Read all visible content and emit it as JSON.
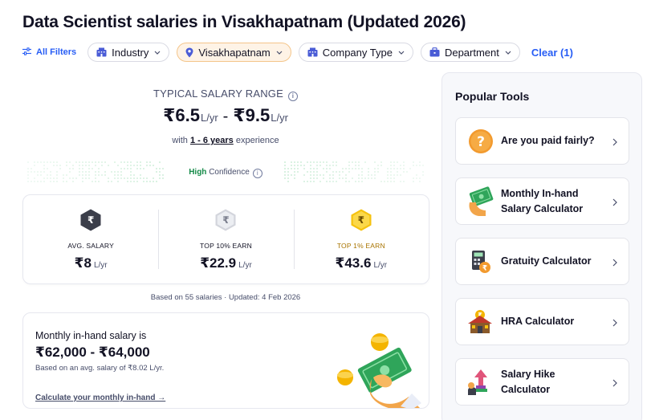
{
  "page": {
    "title": "Data Scientist salaries in Visakhapatnam (Updated 2026)"
  },
  "filters": {
    "all_filters": "All Filters",
    "chips": [
      {
        "label": "Industry",
        "icon": "building-icon",
        "active": false
      },
      {
        "label": "Visakhapatnam",
        "icon": "location-pin-icon",
        "active": true
      },
      {
        "label": "Company Type",
        "icon": "building-icon",
        "active": false
      },
      {
        "label": "Department",
        "icon": "briefcase-icon",
        "active": false
      }
    ],
    "clear": "Clear (1)"
  },
  "salary": {
    "typical_label": "TYPICAL SALARY RANGE",
    "currency": "₹",
    "low": "6.5",
    "high": "9.5",
    "unit": "L/yr",
    "exp_prefix": "with",
    "exp_range": "1 - 6 years",
    "exp_suffix": "experience",
    "confidence_level": "High",
    "confidence_word": "Confidence"
  },
  "stats": [
    {
      "label": "AVG. SALARY",
      "value": "₹8",
      "unit": "L/yr",
      "icon": "rupee-hex-icon",
      "color": "#3b3e4a"
    },
    {
      "label": "TOP 10% EARN",
      "value": "₹22.9",
      "unit": "L/yr",
      "icon": "rupee-hex-icon",
      "color": "#c9cbd3"
    },
    {
      "label": "TOP 1% EARN",
      "value": "₹43.6",
      "unit": "L/yr",
      "icon": "rupee-hex-icon",
      "color": "#f6c20f"
    }
  ],
  "based_on": "Based on 55 salaries · Updated: 4 Feb 2026",
  "inhand": {
    "title": "Monthly in-hand salary is",
    "range": "₹62,000 - ₹64,000",
    "note": "Based on an avg. salary of ₹8.02 L/yr.",
    "link": "Calculate your monthly in-hand →"
  },
  "sidebar": {
    "title": "Popular Tools",
    "tools": [
      {
        "label": "Are you paid fairly?",
        "icon": "question-icon"
      },
      {
        "label": "Monthly In-hand Salary Calculator",
        "icon": "cash-hand-icon"
      },
      {
        "label": "Gratuity Calculator",
        "icon": "calculator-icon"
      },
      {
        "label": "HRA Calculator",
        "icon": "house-icon"
      },
      {
        "label": "Salary Hike Calculator",
        "icon": "hike-arrow-icon"
      }
    ]
  },
  "colors": {
    "accent": "#275DF5",
    "active_chip_bg": "#fef3e6",
    "high_confidence": "#158a48",
    "gold": "#f6c20f"
  }
}
